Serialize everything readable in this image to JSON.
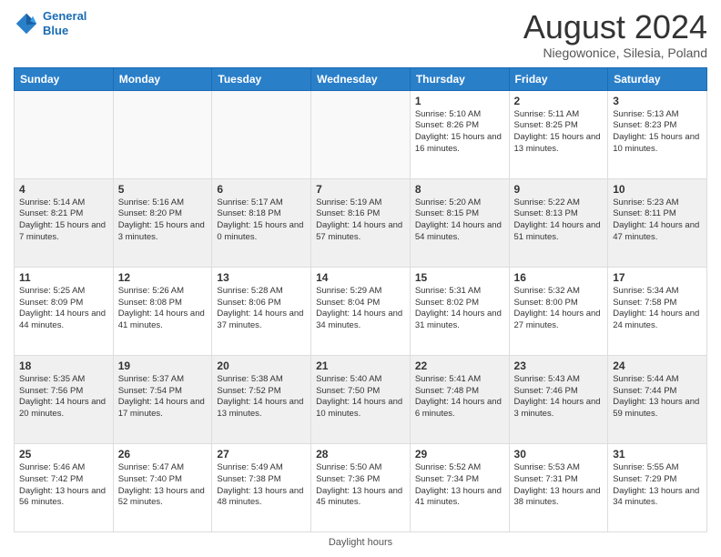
{
  "header": {
    "logo_line1": "General",
    "logo_line2": "Blue",
    "main_title": "August 2024",
    "subtitle": "Niegowonice, Silesia, Poland"
  },
  "days_of_week": [
    "Sunday",
    "Monday",
    "Tuesday",
    "Wednesday",
    "Thursday",
    "Friday",
    "Saturday"
  ],
  "weeks": [
    [
      {
        "num": "",
        "text": ""
      },
      {
        "num": "",
        "text": ""
      },
      {
        "num": "",
        "text": ""
      },
      {
        "num": "",
        "text": ""
      },
      {
        "num": "1",
        "text": "Sunrise: 5:10 AM\nSunset: 8:26 PM\nDaylight: 15 hours and 16 minutes."
      },
      {
        "num": "2",
        "text": "Sunrise: 5:11 AM\nSunset: 8:25 PM\nDaylight: 15 hours and 13 minutes."
      },
      {
        "num": "3",
        "text": "Sunrise: 5:13 AM\nSunset: 8:23 PM\nDaylight: 15 hours and 10 minutes."
      }
    ],
    [
      {
        "num": "4",
        "text": "Sunrise: 5:14 AM\nSunset: 8:21 PM\nDaylight: 15 hours and 7 minutes."
      },
      {
        "num": "5",
        "text": "Sunrise: 5:16 AM\nSunset: 8:20 PM\nDaylight: 15 hours and 3 minutes."
      },
      {
        "num": "6",
        "text": "Sunrise: 5:17 AM\nSunset: 8:18 PM\nDaylight: 15 hours and 0 minutes."
      },
      {
        "num": "7",
        "text": "Sunrise: 5:19 AM\nSunset: 8:16 PM\nDaylight: 14 hours and 57 minutes."
      },
      {
        "num": "8",
        "text": "Sunrise: 5:20 AM\nSunset: 8:15 PM\nDaylight: 14 hours and 54 minutes."
      },
      {
        "num": "9",
        "text": "Sunrise: 5:22 AM\nSunset: 8:13 PM\nDaylight: 14 hours and 51 minutes."
      },
      {
        "num": "10",
        "text": "Sunrise: 5:23 AM\nSunset: 8:11 PM\nDaylight: 14 hours and 47 minutes."
      }
    ],
    [
      {
        "num": "11",
        "text": "Sunrise: 5:25 AM\nSunset: 8:09 PM\nDaylight: 14 hours and 44 minutes."
      },
      {
        "num": "12",
        "text": "Sunrise: 5:26 AM\nSunset: 8:08 PM\nDaylight: 14 hours and 41 minutes."
      },
      {
        "num": "13",
        "text": "Sunrise: 5:28 AM\nSunset: 8:06 PM\nDaylight: 14 hours and 37 minutes."
      },
      {
        "num": "14",
        "text": "Sunrise: 5:29 AM\nSunset: 8:04 PM\nDaylight: 14 hours and 34 minutes."
      },
      {
        "num": "15",
        "text": "Sunrise: 5:31 AM\nSunset: 8:02 PM\nDaylight: 14 hours and 31 minutes."
      },
      {
        "num": "16",
        "text": "Sunrise: 5:32 AM\nSunset: 8:00 PM\nDaylight: 14 hours and 27 minutes."
      },
      {
        "num": "17",
        "text": "Sunrise: 5:34 AM\nSunset: 7:58 PM\nDaylight: 14 hours and 24 minutes."
      }
    ],
    [
      {
        "num": "18",
        "text": "Sunrise: 5:35 AM\nSunset: 7:56 PM\nDaylight: 14 hours and 20 minutes."
      },
      {
        "num": "19",
        "text": "Sunrise: 5:37 AM\nSunset: 7:54 PM\nDaylight: 14 hours and 17 minutes."
      },
      {
        "num": "20",
        "text": "Sunrise: 5:38 AM\nSunset: 7:52 PM\nDaylight: 14 hours and 13 minutes."
      },
      {
        "num": "21",
        "text": "Sunrise: 5:40 AM\nSunset: 7:50 PM\nDaylight: 14 hours and 10 minutes."
      },
      {
        "num": "22",
        "text": "Sunrise: 5:41 AM\nSunset: 7:48 PM\nDaylight: 14 hours and 6 minutes."
      },
      {
        "num": "23",
        "text": "Sunrise: 5:43 AM\nSunset: 7:46 PM\nDaylight: 14 hours and 3 minutes."
      },
      {
        "num": "24",
        "text": "Sunrise: 5:44 AM\nSunset: 7:44 PM\nDaylight: 13 hours and 59 minutes."
      }
    ],
    [
      {
        "num": "25",
        "text": "Sunrise: 5:46 AM\nSunset: 7:42 PM\nDaylight: 13 hours and 56 minutes."
      },
      {
        "num": "26",
        "text": "Sunrise: 5:47 AM\nSunset: 7:40 PM\nDaylight: 13 hours and 52 minutes."
      },
      {
        "num": "27",
        "text": "Sunrise: 5:49 AM\nSunset: 7:38 PM\nDaylight: 13 hours and 48 minutes."
      },
      {
        "num": "28",
        "text": "Sunrise: 5:50 AM\nSunset: 7:36 PM\nDaylight: 13 hours and 45 minutes."
      },
      {
        "num": "29",
        "text": "Sunrise: 5:52 AM\nSunset: 7:34 PM\nDaylight: 13 hours and 41 minutes."
      },
      {
        "num": "30",
        "text": "Sunrise: 5:53 AM\nSunset: 7:31 PM\nDaylight: 13 hours and 38 minutes."
      },
      {
        "num": "31",
        "text": "Sunrise: 5:55 AM\nSunset: 7:29 PM\nDaylight: 13 hours and 34 minutes."
      }
    ]
  ],
  "footer": {
    "daylight_label": "Daylight hours"
  }
}
